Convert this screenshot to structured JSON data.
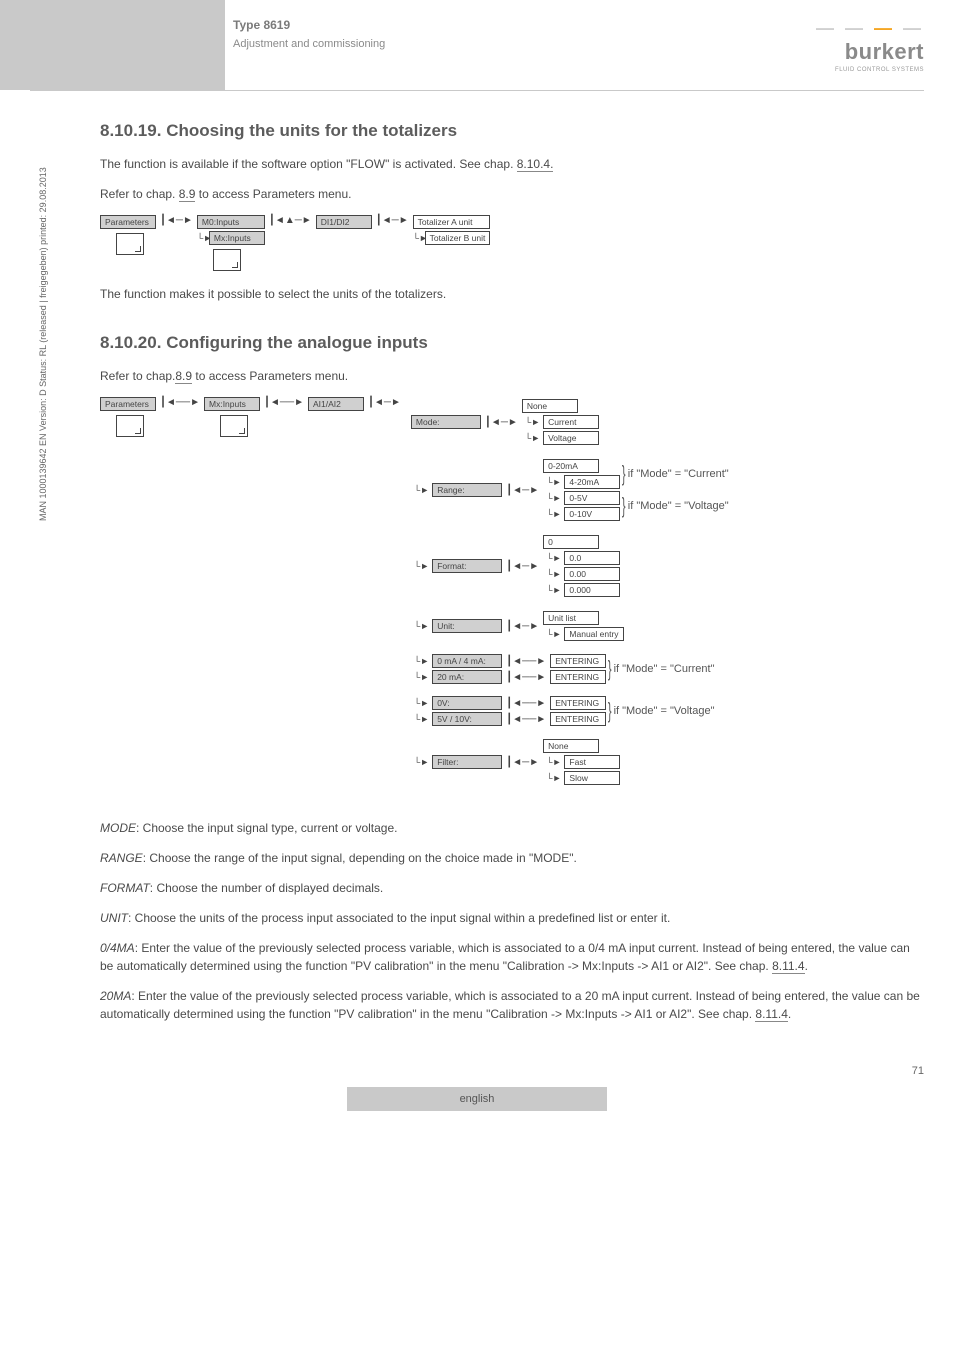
{
  "header": {
    "type_label": "Type 8619",
    "type_sub": "Adjustment and commissioning",
    "logo_name": "burkert",
    "logo_sub": "FLUID CONTROL SYSTEMS"
  },
  "sidebar_text": "MAN 1000139642 EN Version: D Status: RL (released | freigegeben) printed: 29.08.2013",
  "s1": {
    "num": "8.10.19.",
    "title": "Choosing the units for the totalizers",
    "p1a": "The function is available if the software option \"FLOW\" is activated. See chap. ",
    "p1_link": "8.10.4.",
    "p2a": "Refer to chap. ",
    "p2_link": "8.9",
    "p2b": " to access Parameters menu.",
    "d": {
      "parameters": "Parameters",
      "m0": "M0:Inputs",
      "mx": "Mx:Inputs",
      "di": "DI1/DI2",
      "tot_a": "Totalizer A unit",
      "tot_b": "Totalizer B unit"
    },
    "p3": "The function makes it possible to select the units of the totalizers."
  },
  "s2": {
    "num": "8.10.20.",
    "title": "Configuring the analogue inputs",
    "p1a": "Refer to chap.",
    "p1_link": "8.9",
    "p1b": " to access Parameters menu.",
    "d": {
      "parameters": "Parameters",
      "mx": "Mx:Inputs",
      "ai": "AI1/AI2",
      "mode": "Mode:",
      "mode_opts": {
        "none": "None",
        "current": "Current",
        "voltage": "Voltage"
      },
      "range": "Range:",
      "range_opts": {
        "a": "0-20mA",
        "b": "4-20mA",
        "c": "0-5V",
        "d": "0-10V"
      },
      "range_ann_cur": "if \"Mode\" = \"Current\"",
      "range_ann_vol": "if \"Mode\" = \"Voltage\"",
      "format": "Format:",
      "format_opts": {
        "a": "0",
        "b": "0.0",
        "c": "0.00",
        "d": "0.000"
      },
      "unit": "Unit:",
      "unit_opts": {
        "a": "Unit list",
        "b": "Manual entry"
      },
      "cur_a": "0 mA / 4 mA:",
      "cur_b": "20 mA:",
      "vol_a": "0V:",
      "vol_b": "5V / 10V:",
      "entering": "ENTERING",
      "ann_cur": "if \"Mode\" = \"Current\"",
      "ann_vol": "if \"Mode\" = \"Voltage\"",
      "filter": "Filter:",
      "filter_opts": {
        "none": "None",
        "fast": "Fast",
        "slow": "Slow"
      }
    },
    "modeP": "MODE",
    "modeT": ": Choose the input signal type, current or voltage.",
    "rangeP": "RANGE",
    "rangeT": ": Choose the range of the input signal, depending on the choice made in \"MODE\".",
    "formatP": "FORMAT",
    "formatT": ": Choose the number of displayed decimals.",
    "unitP": "UNIT",
    "unitT": ": Choose the units of the process input associated to the input signal within a predefined list or enter it.",
    "z4P": "0/4MA",
    "z4T": ": Enter the value of the previously selected process variable, which is associated to a 0/4 mA input current. Instead of being entered, the value can be automatically determined using the function \"PV calibration\" in the menu \"Calibration -> Mx:Inputs -> AI1 or AI2\". See chap. ",
    "z4L": "8.11.4",
    "z4E": ".",
    "m20P": "20MA",
    "m20T": ": Enter the value of the previously selected process variable, which is associated to a 20 mA input current. Instead of being entered, the value can be automatically determined using the function \"PV calibration\" in the menu \"Calibration -> Mx:Inputs -> AI1 or AI2\". See chap. ",
    "m20L": "8.11.4",
    "m20E": "."
  },
  "footer": {
    "page": "71",
    "lang": "english"
  }
}
